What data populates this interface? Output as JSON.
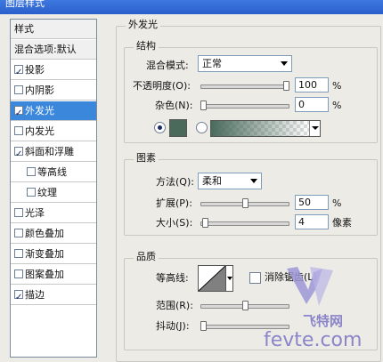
{
  "window": {
    "title": "图层样式"
  },
  "left_panel": {
    "header": "样式",
    "blend_options": "混合选项:默认",
    "items": [
      {
        "label": "投影",
        "checked": true
      },
      {
        "label": "内阴影",
        "checked": false
      },
      {
        "label": "外发光",
        "checked": true,
        "selected": true
      },
      {
        "label": "内发光",
        "checked": false
      },
      {
        "label": "斜面和浮雕",
        "checked": true
      },
      {
        "label": "等高线",
        "checked": false
      },
      {
        "label": "纹理",
        "checked": false
      },
      {
        "label": "光泽",
        "checked": false
      },
      {
        "label": "颜色叠加",
        "checked": false
      },
      {
        "label": "渐变叠加",
        "checked": false
      },
      {
        "label": "图案叠加",
        "checked": false
      },
      {
        "label": "描边",
        "checked": true
      }
    ]
  },
  "outer_glow": {
    "title": "外发光",
    "structure": {
      "title": "结构",
      "blend_mode_label": "混合模式:",
      "blend_mode_value": "正常",
      "opacity_label": "不透明度(O):",
      "opacity_value": "100",
      "opacity_unit": "%",
      "opacity_level": 1.0,
      "noise_label": "杂色(N):",
      "noise_value": "0",
      "noise_unit": "%",
      "noise_level": 0.0,
      "color_swatch": "#4a6b5c",
      "gradient_from": "#4a6b5c"
    },
    "elements": {
      "title": "图素",
      "method_label": "方法(Q):",
      "method_value": "柔和",
      "spread_label": "扩展(P):",
      "spread_value": "50",
      "spread_unit": "%",
      "spread_level": 0.5,
      "size_label": "大小(S):",
      "size_value": "4",
      "size_unit": "像素",
      "size_level": 0.02
    },
    "quality": {
      "title": "品质",
      "contour_label": "等高线:",
      "antialias_label": "消除锯齿(L)",
      "range_label": "范围(R):",
      "range_level": 0.5,
      "jitter_label": "抖动(J):",
      "jitter_level": 0.0
    }
  },
  "watermark": {
    "text": "fevte.com",
    "text2": "飞特网"
  }
}
